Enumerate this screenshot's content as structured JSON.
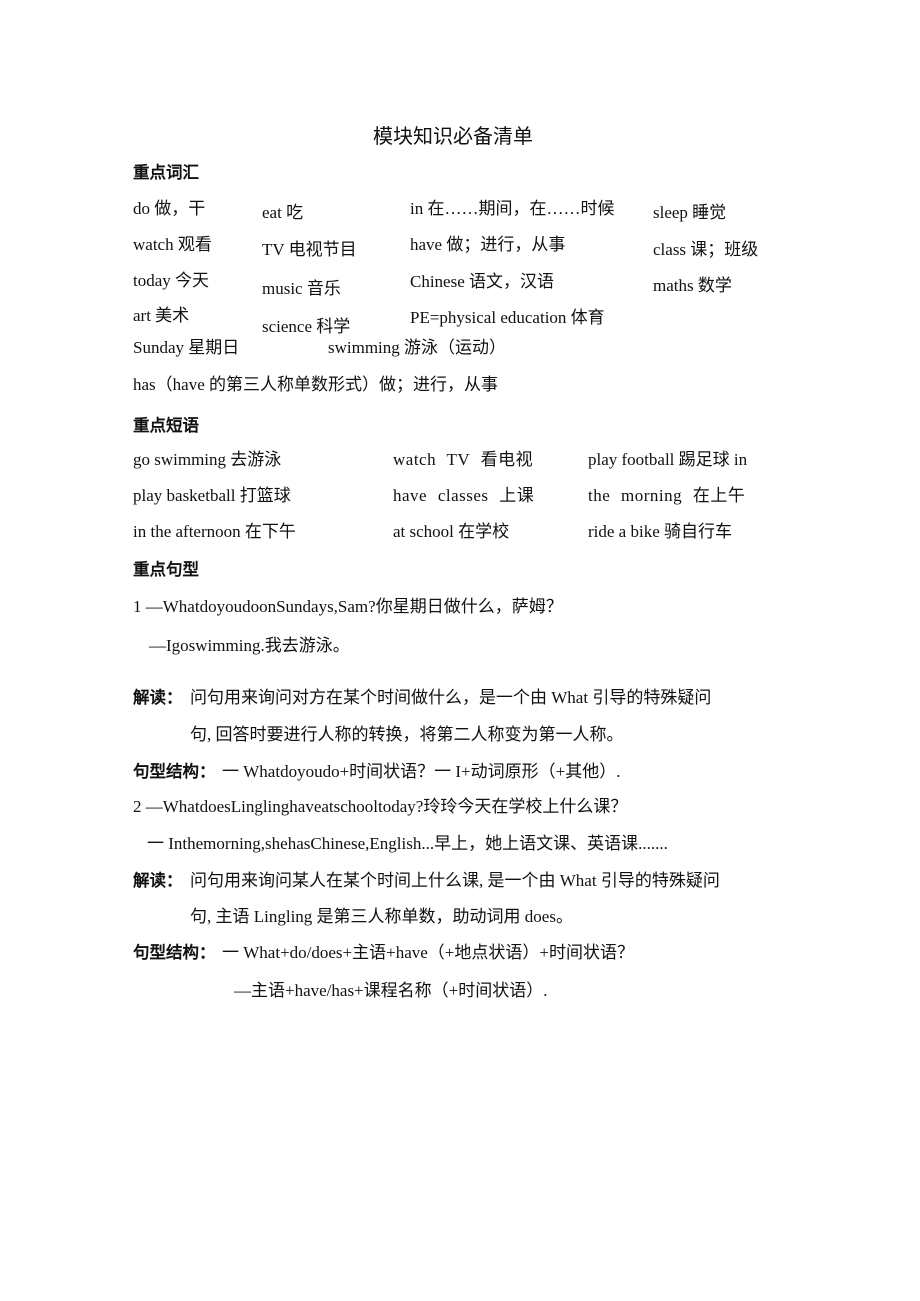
{
  "document": {
    "title": "模块知识必备清单",
    "vocabulary": {
      "heading": "重点词汇",
      "rows": [
        [
          "do 做，干",
          "eat 吃",
          "in 在……期间，在……时候",
          "sleep 睡觉"
        ],
        [
          "watch 观看",
          "TV 电视节目",
          "have 做；进行，从事",
          "class 课；班级"
        ],
        [
          "today 今天",
          "music 音乐",
          "Chinese 语文，汉语",
          "maths 数学"
        ],
        [
          "art 美术",
          "science 科学",
          "PE=physical education 体育",
          ""
        ]
      ],
      "extra": [
        "Sunday 星期日",
        "swimming 游泳（运动）"
      ],
      "has_line": "has（have 的第三人称单数形式）做；进行，从事"
    },
    "phrases": {
      "heading": "重点短语",
      "rows": [
        [
          "go swimming 去游泳",
          "watch TV 看电视",
          "play football 踢足球  in"
        ],
        [
          "play basketball 打篮球",
          "have classes 上课",
          "the morning 在上午"
        ],
        [
          "in the afternoon 在下午",
          "at school 在学校",
          "ride a bike 骑自行车"
        ]
      ]
    },
    "sentences": {
      "heading": "重点句型",
      "items": [
        {
          "q": "1  —WhatdoyoudoonSundays,Sam?你星期日做什么，萨姆？",
          "a": "—Igoswimming.我去游泳。",
          "note_label": "解读：",
          "note_1": "问句用来询问对方在某个时间做什么，是一个由 What 引导的特殊疑问",
          "note_2": "句, 回答时要进行人称的转换，将第二人称变为第一人称。",
          "struct_label": "句型结构：",
          "struct_1": "一 Whatdoyoudo+时间状语？一 I+动词原形（+其他）."
        },
        {
          "q": "2   —WhatdoesLinglinghaveatschooltoday?玲玲今天在学校上什么课？",
          "a": "一 Inthemorning,shehasChinese,English...早上，她上语文课、英语课.......",
          "note_label": "解读：",
          "note_1": "问句用来询问某人在某个时间上什么课, 是一个由 What 引导的特殊疑问",
          "note_2": "句, 主语 Lingling 是第三人称单数，助动词用 does。",
          "struct_label": "句型结构：",
          "struct_1": "一 What+do/does+主语+have（+地点状语）+时间状语？",
          "struct_2": "—主语+have/has+课程名称（+时间状语）."
        }
      ]
    }
  }
}
